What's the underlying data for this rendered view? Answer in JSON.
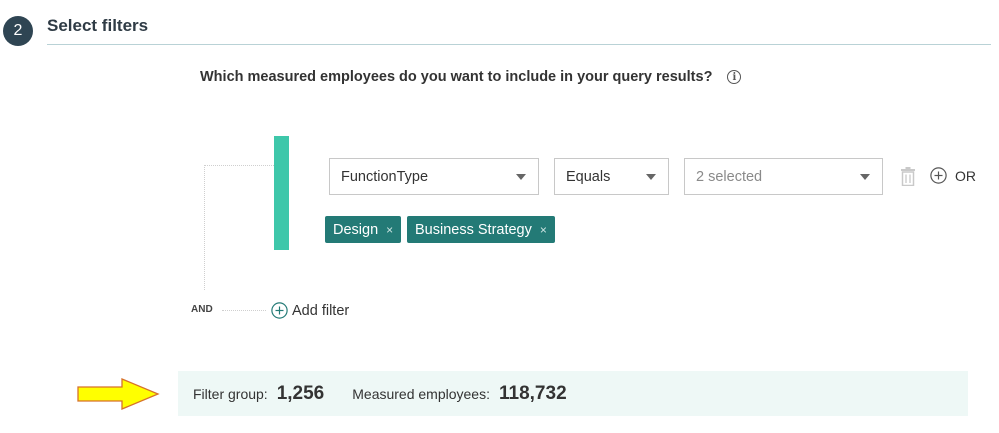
{
  "section": {
    "step_number": "2",
    "title": "Select filters"
  },
  "question": {
    "text": "Which measured employees do you want to include in your query results?",
    "info_icon": "info-icon"
  },
  "filter_group": {
    "group_connector_label": "AND",
    "condition": {
      "field": "FunctionType",
      "operator": "Equals",
      "values_placeholder": "2 selected",
      "or_label": "OR",
      "selected_values": [
        {
          "label": "Design",
          "remove": "×"
        },
        {
          "label": "Business Strategy",
          "remove": "×"
        }
      ]
    },
    "add_filter_label": "Add filter"
  },
  "summary": {
    "filter_group_label": "Filter group:",
    "filter_group_count": "1,256",
    "measured_label": "Measured employees:",
    "measured_count": "118,732"
  },
  "colors": {
    "accent_bar": "#3ec7aa",
    "chip_bg": "#237a76",
    "summary_bg": "#eef8f6",
    "arrow_fill": "#ffff00",
    "arrow_stroke": "#d6722b"
  }
}
